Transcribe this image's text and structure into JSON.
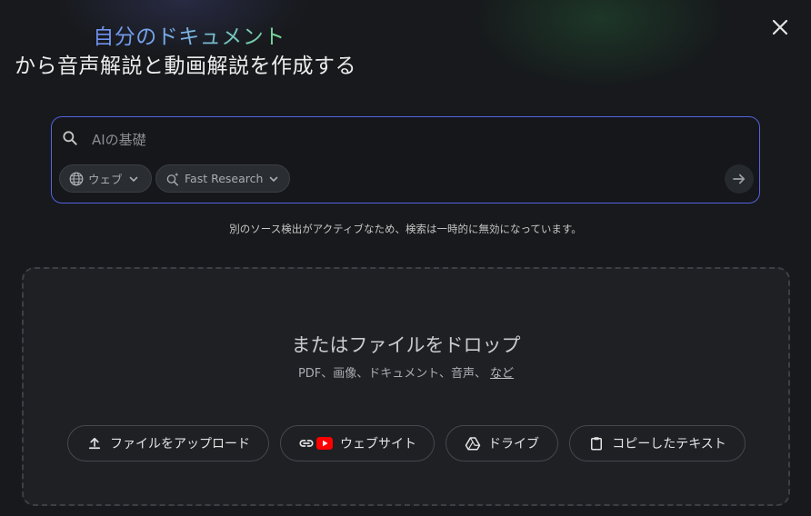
{
  "header": {
    "title_highlight": "自分のドキュメント",
    "title_rest": "から音声解説と動画解説を作成する"
  },
  "close_icon": "close-icon",
  "search": {
    "placeholder": "AIの基礎",
    "value": "",
    "chips": {
      "web_label": "ウェブ",
      "research_label": "Fast Research"
    }
  },
  "notice": "別のソース検出がアクティブなため、検索は一時的に無効になっています。",
  "dropzone": {
    "title": "またはファイルをドロップ",
    "subtitle": "PDF、画像、ドキュメント、音声、",
    "more_link": "など"
  },
  "source_buttons": {
    "upload_label": "ファイルをアップロード",
    "website_label": "ウェブサイト",
    "drive_label": "ドライブ",
    "copied_text_label": "コピーしたテキスト"
  },
  "colors": {
    "background": "#17191c",
    "accent_border": "#5563e0",
    "youtube_red": "#ff0000",
    "title_gradient_start": "#6f8ef0",
    "title_gradient_end": "#73d98f"
  }
}
